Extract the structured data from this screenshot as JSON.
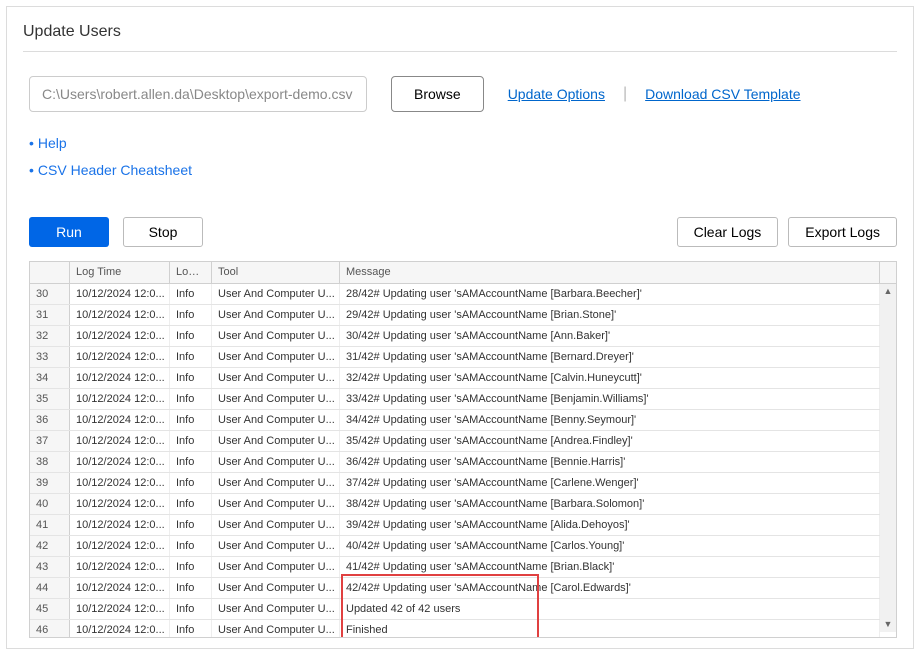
{
  "title": "Update Users",
  "path_value": "C:\\Users\\robert.allen.da\\Desktop\\export-demo.csv",
  "browse_label": "Browse",
  "update_options_label": "Update Options",
  "download_template_label": "Download CSV Template",
  "help_links": {
    "help": "Help",
    "cheatsheet": "CSV Header Cheatsheet"
  },
  "buttons": {
    "run": "Run",
    "stop": "Stop",
    "clear_logs": "Clear Logs",
    "export_logs": "Export Logs"
  },
  "columns": {
    "num": "",
    "log_time": "Log Time",
    "log_type": "Log T...",
    "tool": "Tool",
    "message": "Message"
  },
  "rows": [
    {
      "n": "30",
      "time": "10/12/2024 12:0...",
      "type": "Info",
      "tool": "User And Computer U...",
      "msg": "28/42# Updating user 'sAMAccountName [Barbara.Beecher]'"
    },
    {
      "n": "31",
      "time": "10/12/2024 12:0...",
      "type": "Info",
      "tool": "User And Computer U...",
      "msg": "29/42# Updating user 'sAMAccountName [Brian.Stone]'"
    },
    {
      "n": "32",
      "time": "10/12/2024 12:0...",
      "type": "Info",
      "tool": "User And Computer U...",
      "msg": "30/42# Updating user 'sAMAccountName [Ann.Baker]'"
    },
    {
      "n": "33",
      "time": "10/12/2024 12:0...",
      "type": "Info",
      "tool": "User And Computer U...",
      "msg": "31/42# Updating user 'sAMAccountName [Bernard.Dreyer]'"
    },
    {
      "n": "34",
      "time": "10/12/2024 12:0...",
      "type": "Info",
      "tool": "User And Computer U...",
      "msg": "32/42# Updating user 'sAMAccountName [Calvin.Huneycutt]'"
    },
    {
      "n": "35",
      "time": "10/12/2024 12:0...",
      "type": "Info",
      "tool": "User And Computer U...",
      "msg": "33/42# Updating user 'sAMAccountName [Benjamin.Williams]'"
    },
    {
      "n": "36",
      "time": "10/12/2024 12:0...",
      "type": "Info",
      "tool": "User And Computer U...",
      "msg": "34/42# Updating user 'sAMAccountName [Benny.Seymour]'"
    },
    {
      "n": "37",
      "time": "10/12/2024 12:0...",
      "type": "Info",
      "tool": "User And Computer U...",
      "msg": "35/42# Updating user 'sAMAccountName [Andrea.Findley]'"
    },
    {
      "n": "38",
      "time": "10/12/2024 12:0...",
      "type": "Info",
      "tool": "User And Computer U...",
      "msg": "36/42# Updating user 'sAMAccountName [Bennie.Harris]'"
    },
    {
      "n": "39",
      "time": "10/12/2024 12:0...",
      "type": "Info",
      "tool": "User And Computer U...",
      "msg": "37/42# Updating user 'sAMAccountName [Carlene.Wenger]'"
    },
    {
      "n": "40",
      "time": "10/12/2024 12:0...",
      "type": "Info",
      "tool": "User And Computer U...",
      "msg": "38/42# Updating user 'sAMAccountName [Barbara.Solomon]'"
    },
    {
      "n": "41",
      "time": "10/12/2024 12:0...",
      "type": "Info",
      "tool": "User And Computer U...",
      "msg": "39/42# Updating user 'sAMAccountName [Alida.Dehoyos]'"
    },
    {
      "n": "42",
      "time": "10/12/2024 12:0...",
      "type": "Info",
      "tool": "User And Computer U...",
      "msg": "40/42# Updating user 'sAMAccountName [Carlos.Young]'"
    },
    {
      "n": "43",
      "time": "10/12/2024 12:0...",
      "type": "Info",
      "tool": "User And Computer U...",
      "msg": "41/42# Updating user 'sAMAccountName [Brian.Black]'"
    },
    {
      "n": "44",
      "time": "10/12/2024 12:0...",
      "type": "Info",
      "tool": "User And Computer U...",
      "msg": "42/42# Updating user 'sAMAccountName [Carol.Edwards]'"
    },
    {
      "n": "45",
      "time": "10/12/2024 12:0...",
      "type": "Info",
      "tool": "User And Computer U...",
      "msg": "Updated 42 of 42 users"
    },
    {
      "n": "46",
      "time": "10/12/2024 12:0...",
      "type": "Info",
      "tool": "User And Computer U...",
      "msg": "Finished"
    }
  ]
}
